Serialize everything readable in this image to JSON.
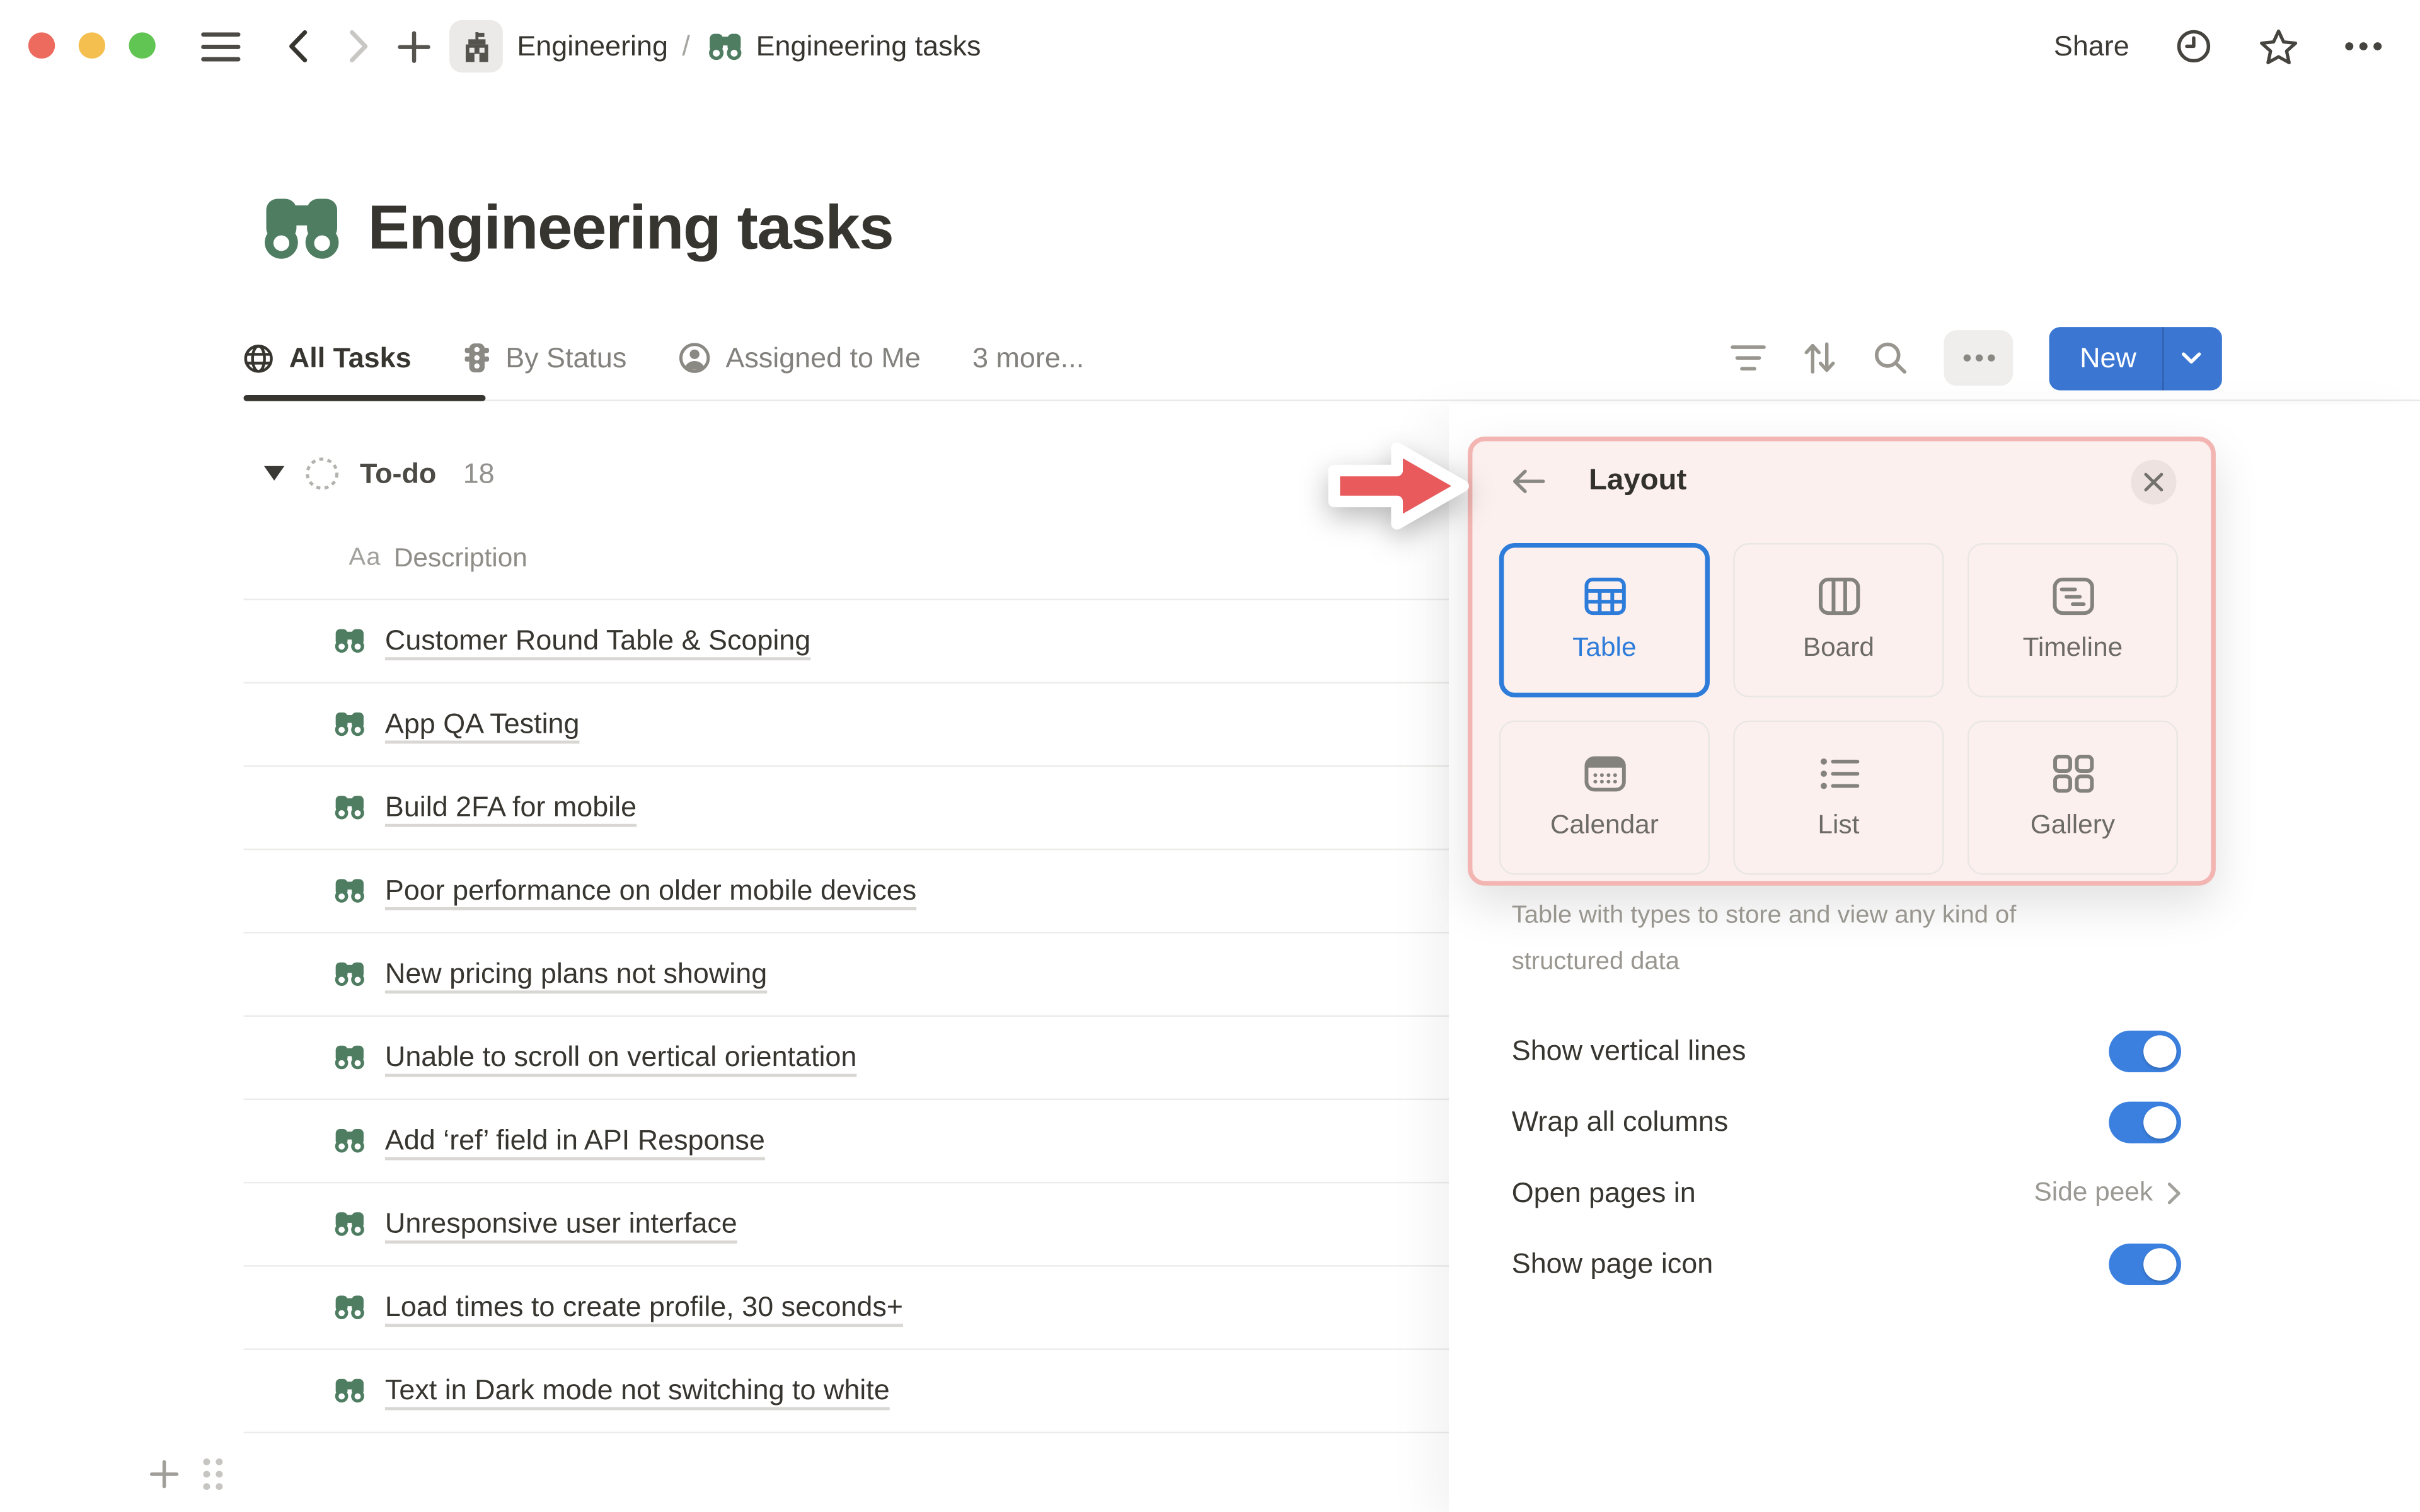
{
  "window": {
    "traffic_lights": [
      "close",
      "minimize",
      "zoom"
    ],
    "breadcrumb": {
      "teamspace": "Engineering",
      "separator": "/",
      "page": "Engineering tasks"
    },
    "share_label": "Share"
  },
  "page": {
    "title": "Engineering tasks"
  },
  "tabs": {
    "items": [
      {
        "label": "All Tasks",
        "active": true
      },
      {
        "label": "By Status",
        "active": false
      },
      {
        "label": "Assigned to Me",
        "active": false
      }
    ],
    "more_label": "3 more...",
    "new_label": "New"
  },
  "group": {
    "name": "To-do",
    "count": "18"
  },
  "table": {
    "column_header": {
      "type_glyph": "Aa",
      "label": "Description"
    },
    "rows": [
      "Customer Round Table & Scoping",
      "App QA Testing",
      "Build 2FA for mobile",
      "Poor performance on older mobile devices",
      "New pricing plans not showing",
      "Unable to scroll on vertical orientation",
      "Add ‘ref’ field in API Response",
      "Unresponsive user interface",
      "Load times to create profile, 30 seconds+",
      "Text in Dark mode not switching to white"
    ]
  },
  "panel": {
    "title": "Layout",
    "layouts": [
      {
        "label": "Table",
        "selected": true
      },
      {
        "label": "Board",
        "selected": false
      },
      {
        "label": "Timeline",
        "selected": false
      },
      {
        "label": "Calendar",
        "selected": false
      },
      {
        "label": "List",
        "selected": false
      },
      {
        "label": "Gallery",
        "selected": false
      }
    ],
    "description": "Table with types to store and view any kind of structured data",
    "settings": [
      {
        "label": "Show vertical lines",
        "type": "toggle",
        "value": true
      },
      {
        "label": "Wrap all columns",
        "type": "toggle",
        "value": true
      },
      {
        "label": "Open pages in",
        "type": "link",
        "value": "Side peek"
      },
      {
        "label": "Show page icon",
        "type": "toggle",
        "value": true
      }
    ]
  },
  "colors": {
    "accent_blue": "#2e7cd9",
    "button_blue": "#3b76d3",
    "toggle_blue": "#3b80df",
    "binoculars_green": "#4f7d62",
    "arrow_red": "#e85a5c",
    "highlight_border": "#f2b5b2",
    "highlight_bg": "#fcf0ef",
    "traffic_red": "#ed6a5e",
    "traffic_yellow": "#f5bf4f",
    "traffic_green": "#61c554"
  }
}
